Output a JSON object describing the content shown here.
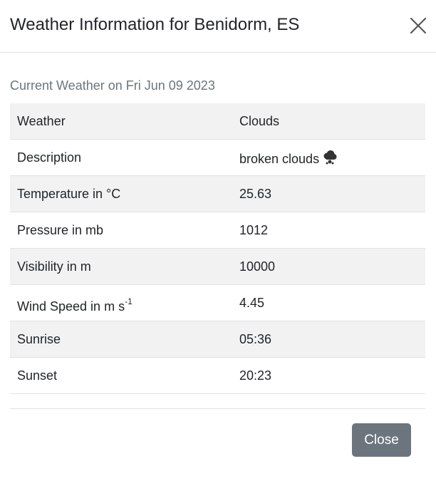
{
  "modal": {
    "title": "Weather Information for Benidorm, ES",
    "subtitle": "Current Weather on Fri Jun 09 2023",
    "close_label": "Close"
  },
  "table": {
    "rows": [
      {
        "label": "Weather",
        "value": "Clouds"
      },
      {
        "label": "Description",
        "value": "broken clouds",
        "icon": "cloud-rain-icon"
      },
      {
        "label": "Temperature in °C",
        "value": "25.63"
      },
      {
        "label": "Pressure in mb",
        "value": "1012"
      },
      {
        "label": "Visibility in m",
        "value": "10000"
      },
      {
        "label": "Wind Speed in m s",
        "label_sup": "-1",
        "value": "4.45"
      },
      {
        "label": "Sunrise",
        "value": "05:36"
      },
      {
        "label": "Sunset",
        "value": "20:23"
      }
    ]
  },
  "colors": {
    "stripe": "#f2f2f2",
    "button": "#6c757d",
    "border": "#dee2e6"
  }
}
